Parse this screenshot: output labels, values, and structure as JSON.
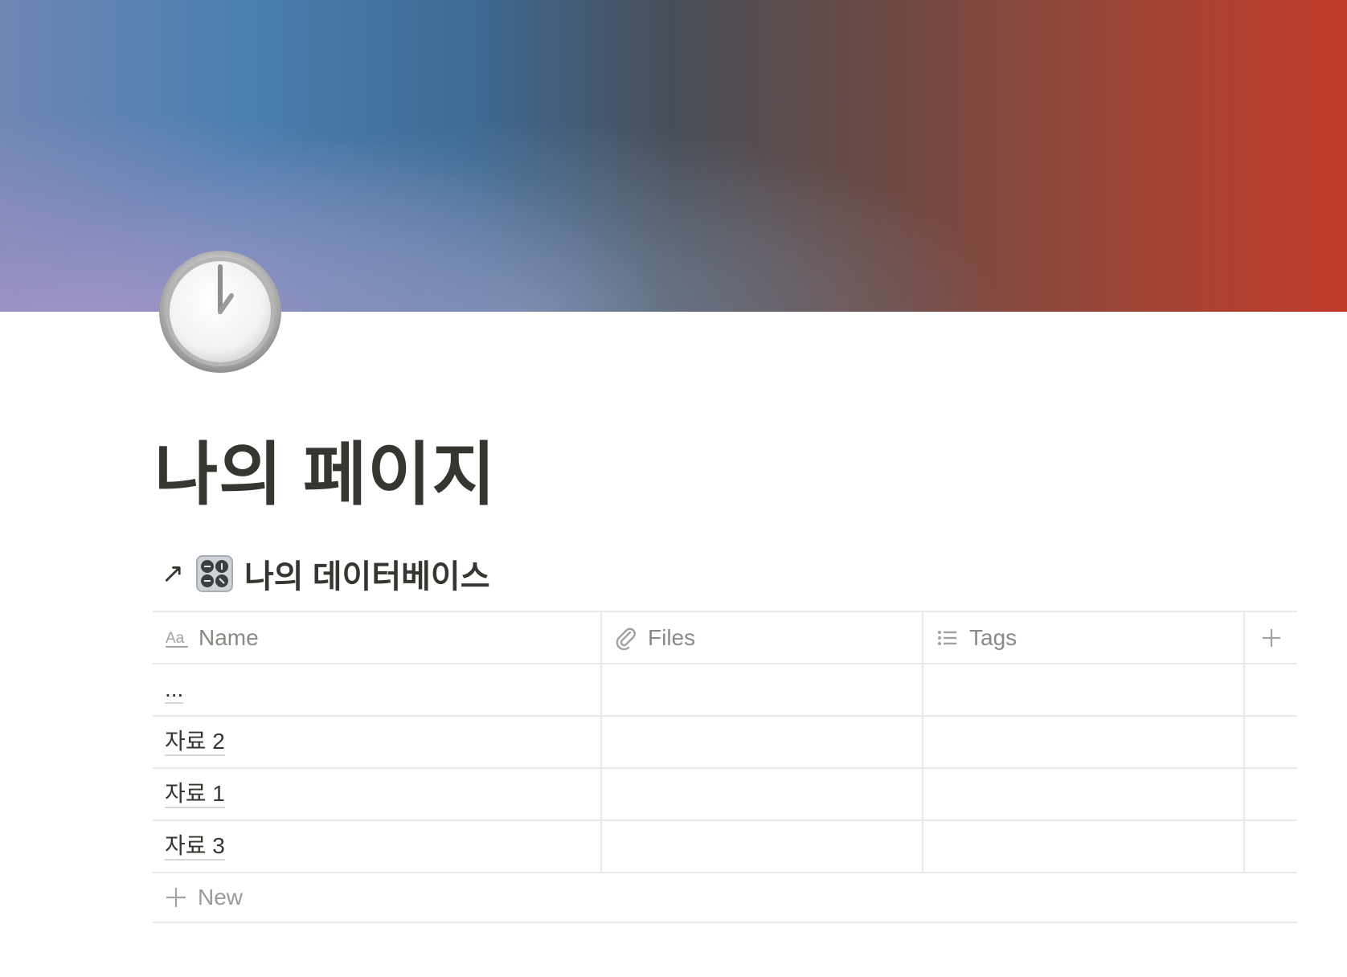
{
  "page": {
    "title": "나의 페이지",
    "icon": "clock-twelve-icon"
  },
  "database": {
    "link_icon": "arrow-up-right-icon",
    "link_glyph": "↗",
    "icon": "control-knobs-icon",
    "title": "나의 데이터베이스",
    "columns": [
      {
        "label": "Name",
        "icon": "text-aa-icon"
      },
      {
        "label": "Files",
        "icon": "paperclip-icon"
      },
      {
        "label": "Tags",
        "icon": "list-icon"
      }
    ],
    "add_column_icon": "plus-icon",
    "rows": [
      {
        "name": "...",
        "files": "",
        "tags": ""
      },
      {
        "name": "자료 2",
        "files": "",
        "tags": ""
      },
      {
        "name": "자료 1",
        "files": "",
        "tags": ""
      },
      {
        "name": "자료 3",
        "files": "",
        "tags": ""
      }
    ],
    "new_label": "New"
  },
  "colors": {
    "text": "#37352f",
    "muted": "#8a8984",
    "border": "#e9e9e7"
  }
}
